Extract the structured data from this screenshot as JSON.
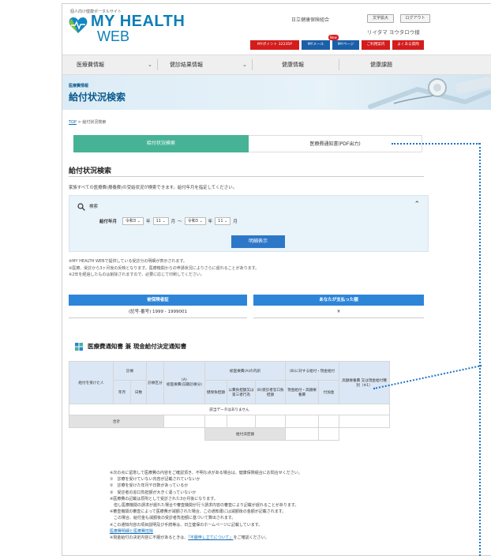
{
  "header": {
    "portal": "個人向け健康ポータルサイト",
    "logo_line1": "MY HEALTH",
    "logo_line2": "WEB",
    "publisher": "日立健康保険組合",
    "btn_zoom": "文字拡大",
    "btn_logout": "ログアウト",
    "user": "リイタマ ヨウタロウ様",
    "nav_badge": "New",
    "nav": [
      {
        "label": "MYポイント 32235P"
      },
      {
        "label": "MYメール"
      },
      {
        "label": "MYページ"
      },
      {
        "label": "ご利用案内"
      },
      {
        "label": "よくある質問"
      }
    ]
  },
  "menu": [
    {
      "label": "医療費情報"
    },
    {
      "label": "健診結果情報"
    },
    {
      "label": "健康情報"
    },
    {
      "label": "健康課題"
    }
  ],
  "banner": {
    "small": "医療費情報",
    "title": "給付状況検索"
  },
  "breadcrumb": {
    "top": "TOP",
    "sep": " > ",
    "current": "給付状況検索"
  },
  "tabs": [
    {
      "label": "給付状況検索"
    },
    {
      "label": "医療費通知書(PDF出力)"
    }
  ],
  "section": {
    "title": "給付状況検索",
    "desc": "家族すべての医療費(療養費)の受給状況が検索できます。給付年月を指定してください。"
  },
  "search": {
    "label": "検索",
    "field_label": "給付年月",
    "era1": "令和3",
    "year_suffix": "年",
    "month1": "11",
    "month_suffix": "月",
    "range_sep": "～",
    "era2": "令和3",
    "month2": "11",
    "button": "明細表示"
  },
  "notes": [
    "※MY HEALTH WEBで提供している受診分の明細が表示されます。",
    "※医療、受診から3ヶ月後の反映となります。医療機関からの申請状況によりさらに遅れることがあります。",
    "※2年を経過したものは削除されますので、必要に応じて印刷してください。"
  ],
  "summary": {
    "h1": "被保険者証",
    "h2": "あなたが支払った額",
    "v1": "(記号-番号) 1999 - 1999001",
    "v2": "¥"
  },
  "table": {
    "title": "医療費通知書 兼 現金給付決定通知書",
    "h_person": "給付を受けた人",
    "h_visit": "診療",
    "h_year": "年月",
    "h_days": "日数",
    "h_kubun": "診療区分",
    "h_a_tag": "(A)",
    "h_a_label": "総医療費(前期診療分)",
    "h_breakdown": "総医療費(A)の内訳",
    "h_insurer": "健保負担額",
    "h_public": "公費負担額又は第三者行為",
    "h_b": "(B)受診者窓口負担額",
    "h_bc": "(B)に対する給付・現金給付",
    "h_cash": "現金給付・高額療養費",
    "h_addon": "付加金",
    "h_remarks": "高額療養費 又は現金給付種別（※1）",
    "nodata": "該当データはありません",
    "total": "合計",
    "decision": "給付決定額"
  },
  "footer": {
    "lines": [
      "※次の点に留意して医療費の内容をご確認頂き、不明な点がある場合は、健康保険組合にお問合せください。",
      "①　診療を受けていない内容が記載されていないか",
      "②　診療を受けた年月や日数があっているか",
      "③　受診者の窓口負担額が大きく違っていないか",
      "※医療費の記載は原則として受診された3か月後になります。",
      "　但し医療機関の請求が遅れた場合や審査機関が行う請求内容の審査により記載が遅れることがあります。",
      "※審査機関の審査によって医療費が減額された場合、この通知書には減額後の金額が記載されます。",
      "　この場合、給付金も減額後の受診者負担額に基づいて算出されます。",
      "※この通知内容の項目説明及び手続等は、日立健保のホームページに記載しています。"
    ],
    "link1": "医療費明細と医療費控除",
    "last_pre": "※現金給付の決定内容に不服があるときは、",
    "link2": "「不服申し立てについて」",
    "last_post": "をご確認ください。"
  },
  "colors": {
    "brand": "#0d7fb5",
    "tab_active": "#46b396",
    "button": "#2d77c8",
    "summary_header": "#2d85d8",
    "annotation": "#1a74c9"
  }
}
